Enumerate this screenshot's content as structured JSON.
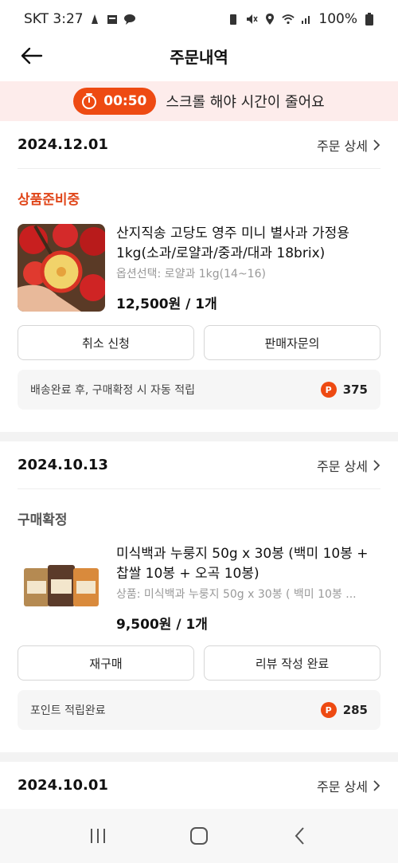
{
  "status_bar": {
    "carrier_time": "SKT 3:27",
    "battery": "100%"
  },
  "header": {
    "title": "주문내역"
  },
  "timer": {
    "time": "00:50",
    "message": "스크롤 해야 시간이 줄어요"
  },
  "detail_label": "주문 상세",
  "orders": [
    {
      "date": "2024.12.01",
      "status": "상품준비중",
      "product_name": "산지직송 고당도 영주 미니 별사과 가정용 1kg(소과/로얄과/중과/대과 18brix)",
      "option": "옵션선택: 로얄과 1kg(14~16)",
      "price": "12,500원 / 1개",
      "button_left": "취소 신청",
      "button_right": "판매자문의",
      "point_text": "배송완료 후, 구매확정 시 자동 적립",
      "point_value": "375"
    },
    {
      "date": "2024.10.13",
      "status": "구매확정",
      "product_name": "미식백과 누룽지 50g x 30봉 (백미 10봉 + 찹쌀 10봉 + 오곡 10봉)",
      "option": "상품: 미식백과 누룽지 50g x 30봉 ( 백미 10봉 ...",
      "price": "9,500원 / 1개",
      "button_left": "재구매",
      "button_right": "리뷰 작성 완료",
      "point_text": "포인트 적립완료",
      "point_value": "285"
    },
    {
      "date": "2024.10.01"
    }
  ],
  "colors": {
    "accent": "#ee4a12",
    "banner_bg": "#fdeceb",
    "status_prep": "#e0471b"
  }
}
